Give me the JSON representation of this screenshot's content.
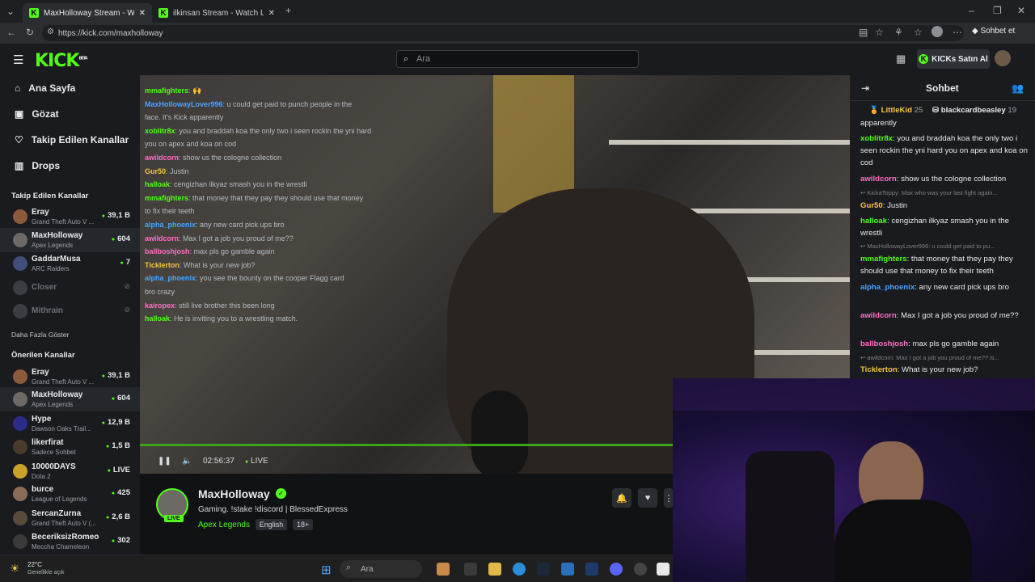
{
  "browser": {
    "tabs": [
      {
        "title": "MaxHolloway Stream - Watch Live",
        "active": true
      },
      {
        "title": "ilkinsan Stream - Watch Live on Ki",
        "active": false
      }
    ],
    "url": "https://kick.com/maxholloway",
    "profile_label": "Sohbet et"
  },
  "header": {
    "logo": "KICK",
    "logo_badge": "BETA",
    "search_placeholder": "Ara",
    "buy_kicks_label": "KICKs Satın Al"
  },
  "sidebar": {
    "nav": [
      {
        "label": "Ana Sayfa",
        "icon": "home-icon"
      },
      {
        "label": "Gözat",
        "icon": "browse-icon"
      },
      {
        "label": "Takip Edilen Kanallar",
        "icon": "heart-icon"
      },
      {
        "label": "Drops",
        "icon": "drops-icon"
      }
    ],
    "followed_title": "Takip Edilen Kanallar",
    "followed": [
      {
        "name": "Eray",
        "game": "Grand Theft Auto V ...",
        "viewers": "39,1 B"
      },
      {
        "name": "MaxHolloway",
        "game": "Apex Legends",
        "viewers": "604"
      },
      {
        "name": "GaddarMusa",
        "game": "ARC Raiders",
        "viewers": "7"
      },
      {
        "name": "Closer",
        "game": "",
        "viewers": ""
      },
      {
        "name": "Mithrain",
        "game": "",
        "viewers": ""
      }
    ],
    "show_more": "Daha Fazla Göster",
    "recommended_title": "Önerilen Kanallar",
    "recommended": [
      {
        "name": "Eray",
        "game": "Grand Theft Auto V ...",
        "viewers": "39,1 B"
      },
      {
        "name": "MaxHolloway",
        "game": "Apex Legends",
        "viewers": "604"
      },
      {
        "name": "Hype",
        "game": "Dawson Oaks Trail...",
        "viewers": "12,9 B"
      },
      {
        "name": "likerfirat",
        "game": "Sadece Sohbet",
        "viewers": "1,5 B"
      },
      {
        "name": "10000DAYS",
        "game": "Dota 2",
        "viewers": "LIVE"
      },
      {
        "name": "burce",
        "game": "League of Legends",
        "viewers": "425"
      },
      {
        "name": "SercanZurna",
        "game": "Grand Theft Auto V (...",
        "viewers": "2,6 B"
      },
      {
        "name": "BeceriksizRomeo",
        "game": "Meccha Chameleon",
        "viewers": "302"
      }
    ]
  },
  "video": {
    "time": "02:56:37",
    "live_label": "LIVE",
    "progress": 1.0,
    "overlay_chat": [
      {
        "user": "mmafighters",
        "text": ": 🙌"
      },
      {
        "user": "MaxHollowayLover996",
        "text": ": u could get paid to punch people in the"
      },
      {
        "user": "",
        "text": "face. It's Kick apparently"
      },
      {
        "user": "xoblitr8x",
        "text": ": you and braddah koa the only two i seen rockin the yni hard"
      },
      {
        "user": "",
        "text": "you on apex and koa on cod"
      },
      {
        "user": "awildcorn",
        "text": ": show us the cologne collection"
      },
      {
        "user": "Gur50",
        "text": ": Justin"
      },
      {
        "user": "halloak",
        "text": ": cengizhan ilkyaz smash you in the wrestli"
      },
      {
        "user": "mmafighters",
        "text": ": that money that they pay they should use that money"
      },
      {
        "user": "",
        "text": "to fix their teeth"
      },
      {
        "user": "alpha_phoenix",
        "text": ": any new card pick ups bro"
      },
      {
        "user": "awildcorn",
        "text": ": Max I got a job you proud of me??"
      },
      {
        "user": "ballboshjosh",
        "text": ": max pls go gamble again"
      },
      {
        "user": "Ticklerton",
        "text": ": What is your new job?"
      },
      {
        "user": "alpha_phoenix",
        "text": ": you see the bounty on the cooper Flagg card"
      },
      {
        "user": "",
        "text": "bro crazy"
      },
      {
        "user": "kairopex",
        "text": ": still live brother this been long"
      },
      {
        "user": "halloak",
        "text": ": He is inviting you to a wrestling match."
      }
    ]
  },
  "channel": {
    "name": "MaxHolloway",
    "title": "Gaming. !stake !discord | BlessedExpress",
    "category": "Apex Legends",
    "tags": [
      "English",
      "18+"
    ],
    "live_badge": "LIVE"
  },
  "chat": {
    "title": "Sohbet",
    "pinned": [
      {
        "user": "LittleKid",
        "count": "25"
      },
      {
        "user": "blackcardbeasley",
        "count": "19"
      }
    ],
    "messages": [
      {
        "type": "text",
        "user": "",
        "text": "apparently",
        "color": "#e8ecee"
      },
      {
        "type": "msg",
        "user": "xoblitr8x",
        "text": ": you and braddah koa the only two i seen rockin the yni hard you on apex and koa on cod",
        "color": "#53fc18"
      },
      {
        "type": "msg",
        "user": "awildcorn",
        "text": ": show us the cologne collection",
        "color": "#ff6ec7"
      },
      {
        "type": "reply",
        "text": "KickaToppy: Max who was your last fight again..."
      },
      {
        "type": "msg",
        "user": "Gur50",
        "text": ": Justin",
        "color": "#f5c542"
      },
      {
        "type": "msg",
        "user": "halloak",
        "text": ": cengizhan ilkyaz smash you in the wrestli",
        "color": "#53fc18"
      },
      {
        "type": "reply",
        "text": "MaxHollowayLover996: u could get paid to pu..."
      },
      {
        "type": "msg",
        "user": "mmafighters",
        "text": ": that money that they pay they should use that money to fix their teeth",
        "color": "#53fc18"
      },
      {
        "type": "msg",
        "user": "alpha_phoenix",
        "text": ": any new card pick ups bro",
        "color": "#4aa3ff"
      },
      {
        "type": "msg",
        "user": "awildcorn",
        "text": ": Max I got a job you proud of me??",
        "color": "#ff6ec7"
      },
      {
        "type": "msg",
        "user": "ballboshjosh",
        "text": ": max pls go gamble again",
        "color": "#ff6ec7"
      },
      {
        "type": "reply",
        "text": "awildcorn: Max I got a job you proud of me?? is..."
      },
      {
        "type": "msg",
        "user": "Ticklerton",
        "text": ": What is your new job?",
        "color": "#f5c542"
      }
    ]
  },
  "taskbar": {
    "weather_temp": "22°C",
    "weather_text": "Genellikle açık",
    "search_placeholder": "Ara"
  }
}
